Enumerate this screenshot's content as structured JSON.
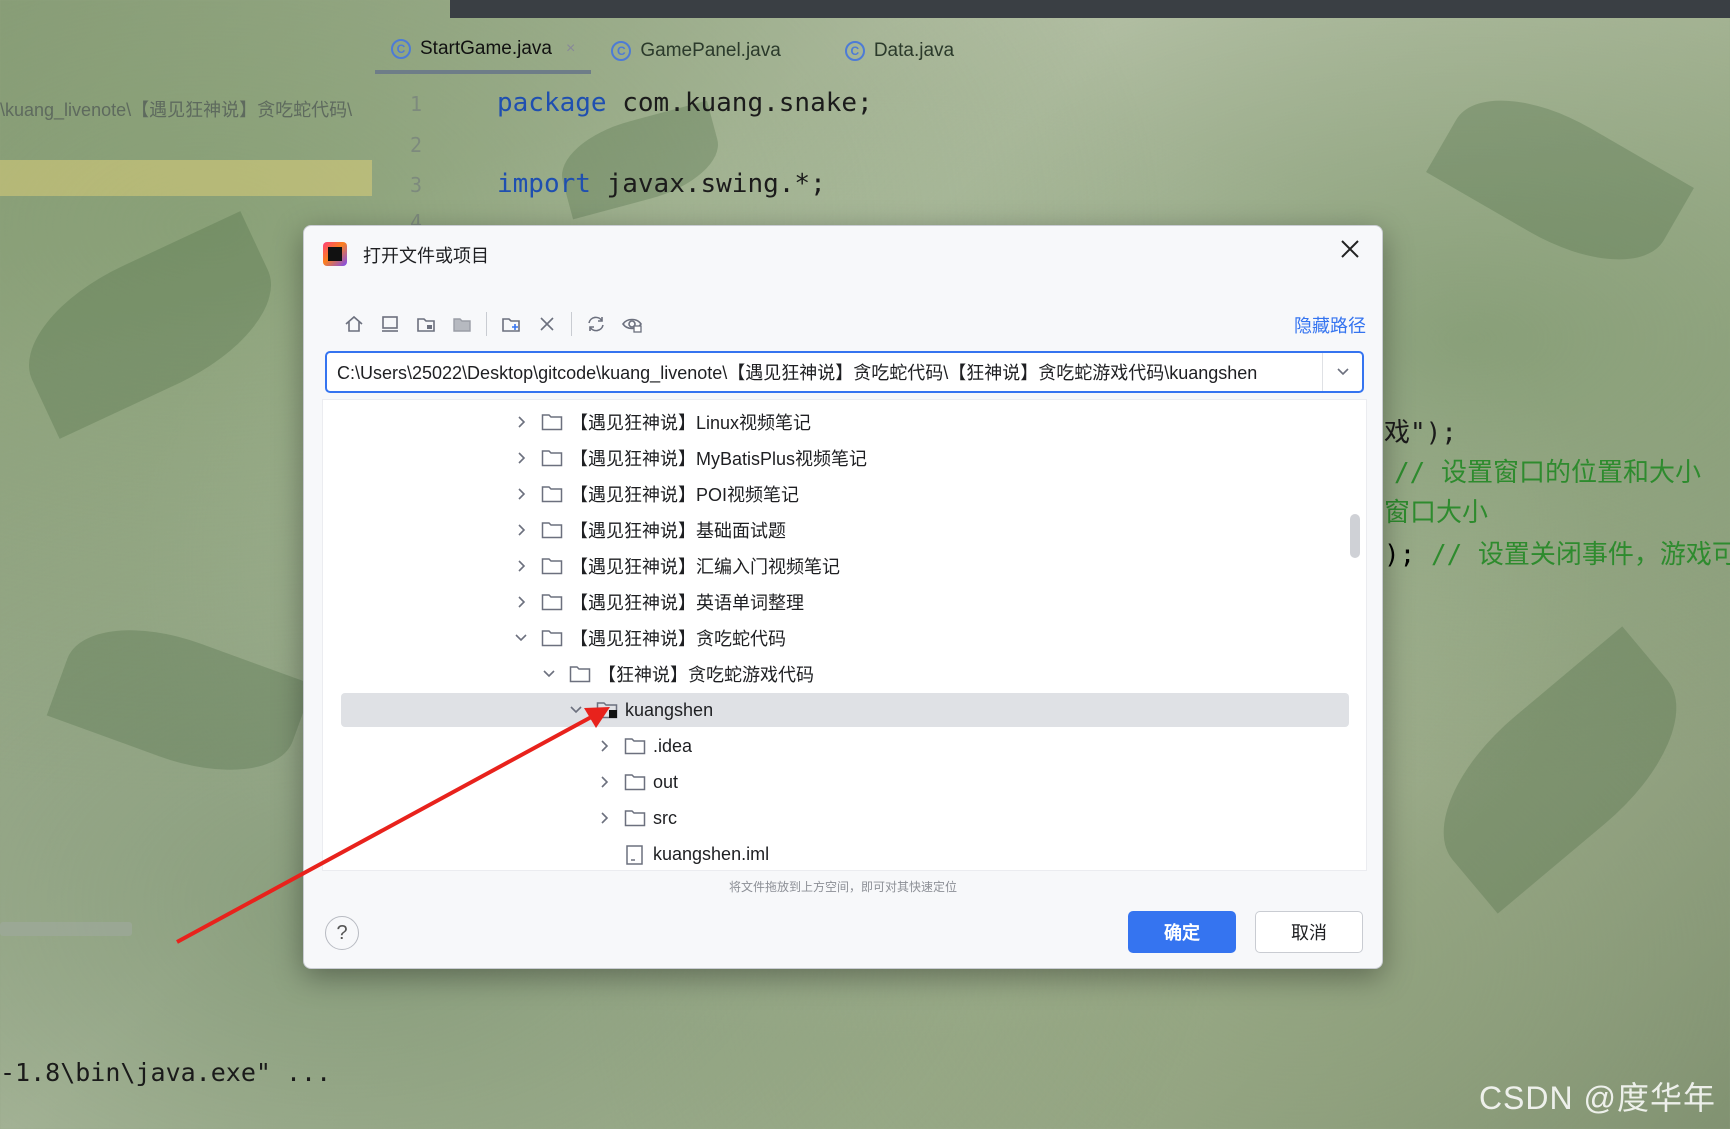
{
  "ide": {
    "tabs": [
      {
        "label": "StartGame.java",
        "active": true
      },
      {
        "label": "GamePanel.java",
        "active": false
      },
      {
        "label": "Data.java",
        "active": false
      }
    ],
    "breadcrumb": "\\kuang_livenote\\【遇见狂神说】贪吃蛇代码\\",
    "code": {
      "line1": {
        "num": "1",
        "kw": "package",
        "rest": " com.kuang.snake;"
      },
      "line2": {
        "num": "2"
      },
      "line3": {
        "num": "3",
        "kw": "import",
        "rest": " javax.swing.*;"
      },
      "line4": {
        "num": "4"
      }
    },
    "side_code": {
      "l1": "戏\");",
      "l2": "// 设置窗口的位置和大小",
      "l3": "窗口大小",
      "l4_code": "); ",
      "l4_comment": "// 设置关闭事件，游戏可"
    },
    "console_line": "-1.8\\bin\\java.exe\" ...",
    "watermark": "CSDN @度华年"
  },
  "dialog": {
    "title": "打开文件或项目",
    "hide_path": "隐藏路径",
    "path_value": "C:\\Users\\25022\\Desktop\\gitcode\\kuang_livenote\\【遇见狂神说】贪吃蛇代码\\【狂神说】贪吃蛇游戏代码\\kuangshen",
    "tree": [
      {
        "label": "【遇见狂神说】Linux视频笔记",
        "depth": 0,
        "expanded": false,
        "type": "folder"
      },
      {
        "label": "【遇见狂神说】MyBatisPlus视频笔记",
        "depth": 0,
        "expanded": false,
        "type": "folder"
      },
      {
        "label": "【遇见狂神说】POI视频笔记",
        "depth": 0,
        "expanded": false,
        "type": "folder"
      },
      {
        "label": "【遇见狂神说】基础面试题",
        "depth": 0,
        "expanded": false,
        "type": "folder"
      },
      {
        "label": "【遇见狂神说】汇编入门视频笔记",
        "depth": 0,
        "expanded": false,
        "type": "folder"
      },
      {
        "label": "【遇见狂神说】英语单词整理",
        "depth": 0,
        "expanded": false,
        "type": "folder"
      },
      {
        "label": "【遇见狂神说】贪吃蛇代码",
        "depth": 0,
        "expanded": true,
        "type": "folder"
      },
      {
        "label": "【狂神说】贪吃蛇游戏代码",
        "depth": 1,
        "expanded": true,
        "type": "folder"
      },
      {
        "label": "kuangshen",
        "depth": 2,
        "expanded": true,
        "type": "project-folder",
        "selected": true
      },
      {
        "label": ".idea",
        "depth": 3,
        "expanded": false,
        "type": "folder"
      },
      {
        "label": "out",
        "depth": 3,
        "expanded": false,
        "type": "folder"
      },
      {
        "label": "src",
        "depth": 3,
        "expanded": false,
        "type": "folder"
      },
      {
        "label": "kuangshen.iml",
        "depth": 3,
        "expanded": null,
        "type": "file"
      }
    ],
    "hint": "将文件拖放到上方空间，即可对其快速定位",
    "help_label": "?",
    "ok_label": "确定",
    "cancel_label": "取消",
    "toolbar_icons": [
      "home-icon",
      "desktop-icon",
      "project-folder-icon",
      "module-folder-icon",
      "new-folder-icon",
      "delete-icon",
      "refresh-icon",
      "show-hidden-icon"
    ]
  },
  "colors": {
    "accent": "#3574f0",
    "annotation_arrow": "#e8221c"
  }
}
